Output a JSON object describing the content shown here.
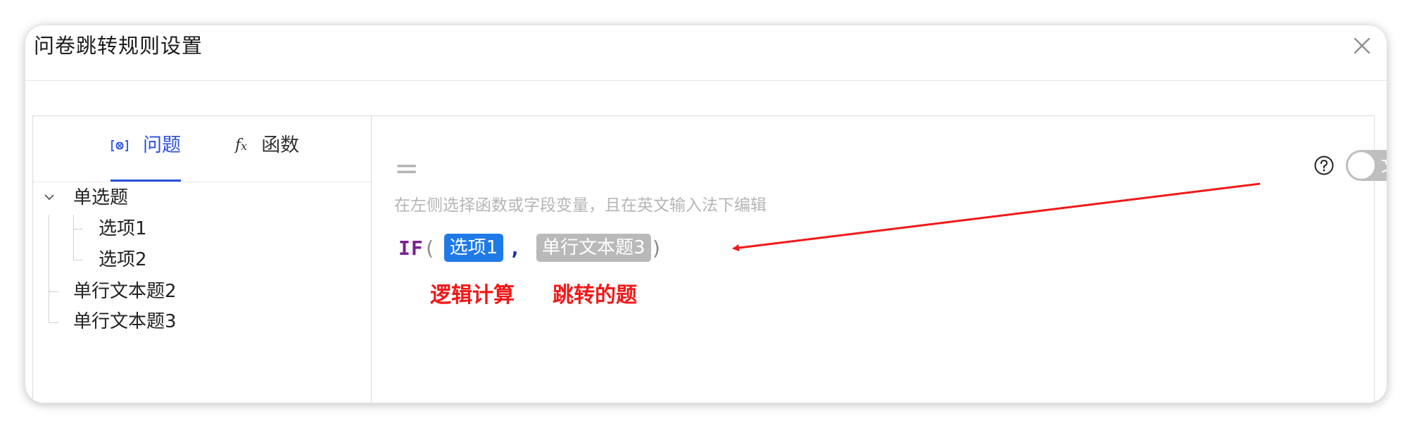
{
  "dialog": {
    "title": "问卷跳转规则设置"
  },
  "left_panel": {
    "tabs": [
      {
        "label": "问题",
        "icon": "variable-brackets-icon",
        "active": true
      },
      {
        "label": "函数",
        "icon": "function-fx-icon",
        "active": false
      }
    ],
    "tree": {
      "group_label": "单选题",
      "group_expanded": true,
      "children": [
        "选项1",
        "选项2"
      ],
      "siblings": [
        "单行文本题2",
        "单行文本题3"
      ]
    }
  },
  "editor": {
    "equals": "=",
    "hint": "在左侧选择函数或字段变量，且在英文输入法下编辑",
    "toggle_label": "文本",
    "toggle_on": false,
    "formula": {
      "function": "IF",
      "open_paren": "(",
      "arg1": "选项1",
      "separator": ",",
      "arg2": "单行文本题3",
      "close_paren": ")"
    }
  },
  "annotations": {
    "logic_label": "逻辑计算",
    "jump_label": "跳转的题",
    "color": "#f21818"
  },
  "colors": {
    "accent": "#2b50d9",
    "chip_field": "#1f7ae8",
    "chip_text": "#b9b9b9",
    "function_name": "#7a1f90"
  }
}
